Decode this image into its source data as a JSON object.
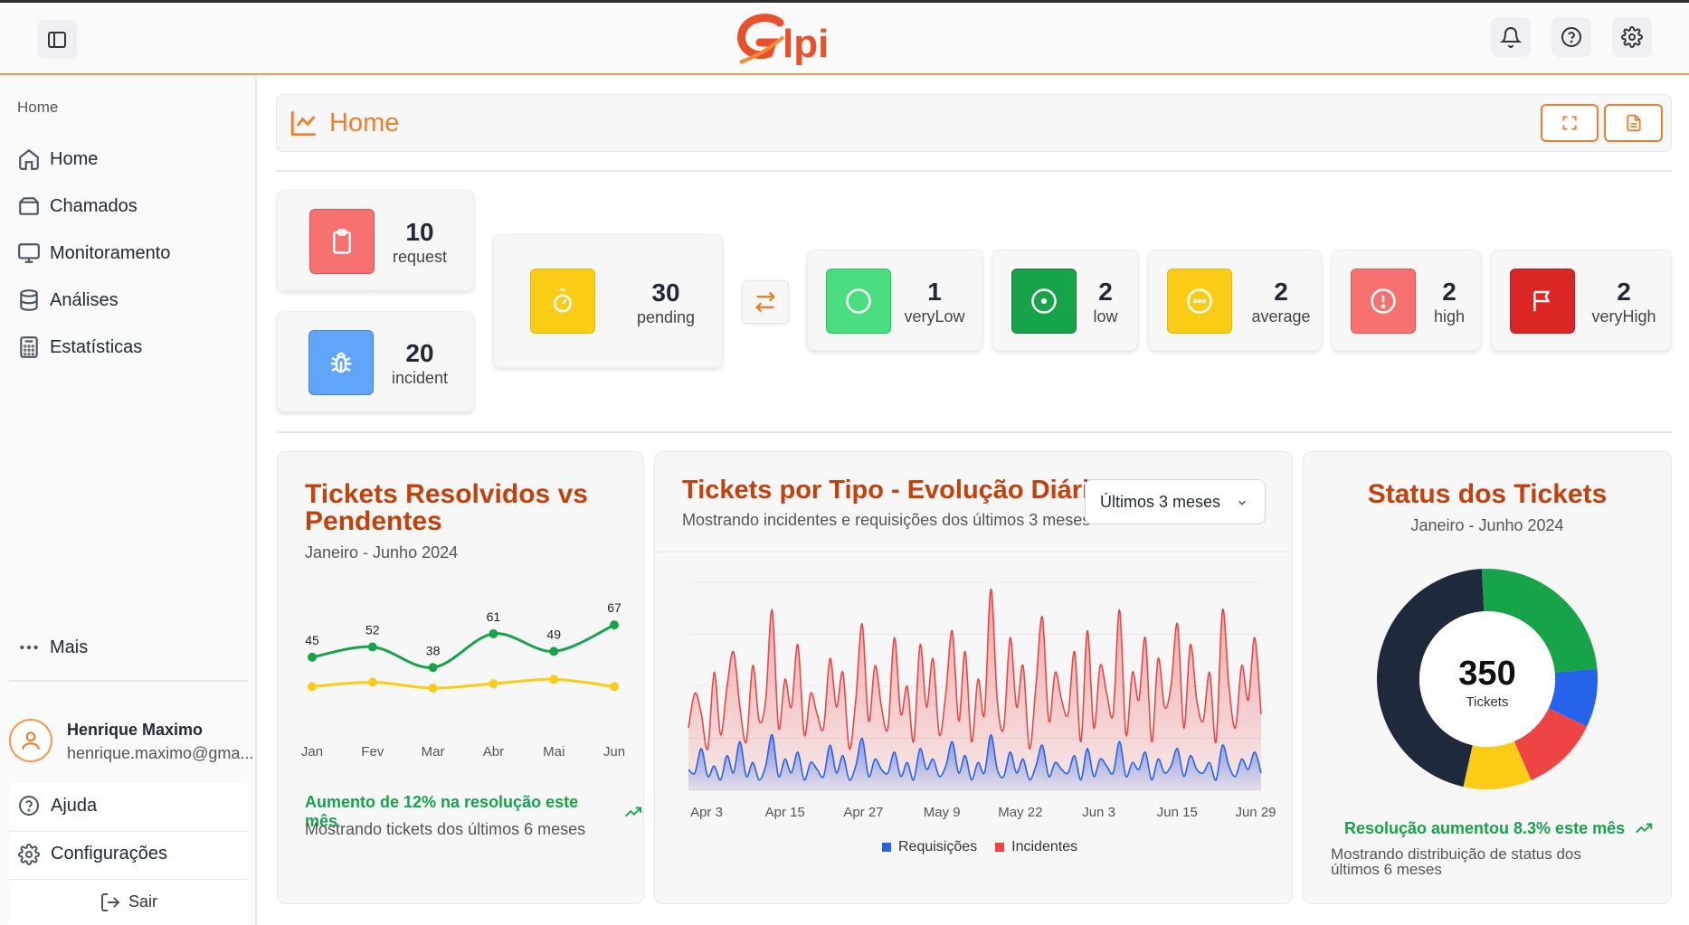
{
  "app": {
    "logo_text": "Glpi"
  },
  "sidebar": {
    "section_title": "Home",
    "items": [
      {
        "label": "Home",
        "icon": "home-icon"
      },
      {
        "label": "Chamados",
        "icon": "ticket-icon"
      },
      {
        "label": "Monitoramento",
        "icon": "monitor-icon"
      },
      {
        "label": "Análises",
        "icon": "database-icon"
      },
      {
        "label": "Estatísticas",
        "icon": "calculator-icon"
      }
    ],
    "more_label": "Mais",
    "user": {
      "name": "Henrique Maximo",
      "email": "henrique.maximo@gma..."
    },
    "help_label": "Ajuda",
    "settings_label": "Configurações",
    "logout_label": "Sair"
  },
  "header": {
    "title": "Home"
  },
  "stats": {
    "request": {
      "value": "10",
      "label": "request"
    },
    "incident": {
      "value": "20",
      "label": "incident"
    },
    "pending": {
      "value": "30",
      "label": "pending"
    },
    "veryLow": {
      "value": "1",
      "label": "veryLow"
    },
    "low": {
      "value": "2",
      "label": "low"
    },
    "average": {
      "value": "2",
      "label": "average"
    },
    "high": {
      "value": "2",
      "label": "high"
    },
    "veryHigh": {
      "value": "2",
      "label": "veryHigh"
    }
  },
  "colors": {
    "accent": "#f07d2a",
    "title": "#c2410c",
    "green": "#16a34a",
    "yellow": "#facc15",
    "blue": "#2563eb",
    "red": "#ef4444",
    "dark": "#1e293b"
  },
  "chart_data": [
    {
      "type": "line",
      "title_line1": "Tickets Resolvidos vs",
      "title_line2": "Pendentes",
      "subtitle": "Janeiro - Junho 2024",
      "categories": [
        "Jan",
        "Fev",
        "Mar",
        "Abr",
        "Mai",
        "Jun"
      ],
      "series": [
        {
          "color": "#16a34a",
          "values": [
            45,
            52,
            38,
            61,
            49,
            67
          ],
          "labels_shown": true
        },
        {
          "color": "#facc15",
          "values": [
            25,
            28,
            24,
            27,
            30,
            25
          ],
          "labels_shown": false
        }
      ],
      "ylim": [
        0,
        80
      ],
      "trend_text": "Aumento de 12% na resolução este mês",
      "note": "Mostrando tickets dos últimos 6 meses"
    },
    {
      "type": "area",
      "title": "Tickets por Tipo - Evolução Diária",
      "subtitle": "Mostrando incidentes e requisições dos últimos 3 meses",
      "range_select": "Últimos 3 meses",
      "x_ticks": [
        "Apr 3",
        "Apr 15",
        "Apr 27",
        "May 9",
        "May 22",
        "Jun 3",
        "Jun 15",
        "Jun 29"
      ],
      "series": [
        {
          "name": "Requisições",
          "color": "#2563eb",
          "values": [
            30,
            25,
            60,
            20,
            35,
            15,
            50,
            25,
            70,
            20,
            40,
            15,
            35,
            80,
            20,
            45,
            25,
            55,
            15,
            40,
            30,
            20,
            65,
            25,
            50,
            15,
            35,
            75,
            20,
            45,
            30,
            25,
            55,
            20,
            40,
            15,
            60,
            30,
            45,
            20,
            35,
            70,
            25,
            50,
            15,
            40,
            25,
            80,
            30,
            20,
            55,
            25,
            45,
            15,
            35,
            65,
            20,
            40,
            30,
            25,
            50,
            15,
            60,
            20,
            45,
            35,
            25,
            70,
            20,
            40,
            30,
            55,
            15,
            45,
            25,
            35,
            60,
            20,
            50,
            30,
            25,
            40,
            15,
            65,
            35,
            20,
            45,
            30,
            55,
            25
          ]
        },
        {
          "name": "Incidentes",
          "color": "#ef4444",
          "values": [
            90,
            140,
            110,
            60,
            170,
            80,
            150,
            200,
            120,
            70,
            180,
            100,
            130,
            260,
            90,
            160,
            120,
            210,
            80,
            140,
            110,
            90,
            190,
            120,
            170,
            60,
            130,
            240,
            100,
            180,
            120,
            90,
            220,
            110,
            150,
            70,
            210,
            120,
            190,
            80,
            140,
            230,
            100,
            200,
            70,
            160,
            110,
            290,
            130,
            90,
            220,
            120,
            180,
            60,
            150,
            250,
            100,
            170,
            130,
            110,
            200,
            70,
            230,
            90,
            180,
            140,
            110,
            260,
            80,
            170,
            130,
            220,
            70,
            190,
            120,
            150,
            240,
            90,
            210,
            130,
            100,
            170,
            70,
            260,
            150,
            90,
            180,
            130,
            220,
            110
          ]
        }
      ],
      "ylim": [
        0,
        300
      ]
    },
    {
      "type": "pie",
      "title": "Status dos Tickets",
      "subtitle": "Janeiro - Junho 2024",
      "center_value": "350",
      "center_label": "Tickets",
      "slices": [
        {
          "color": "#16a34a",
          "value": 85
        },
        {
          "color": "#2563eb",
          "value": 30
        },
        {
          "color": "#ef4444",
          "value": 40
        },
        {
          "color": "#facc15",
          "value": 35
        },
        {
          "color": "#1e293b",
          "value": 160
        }
      ],
      "trend_text": "Resolução aumentou 8.3% este mês",
      "note_line1": "Mostrando distribuição de status dos",
      "note_line2": "últimos 6 meses"
    }
  ]
}
